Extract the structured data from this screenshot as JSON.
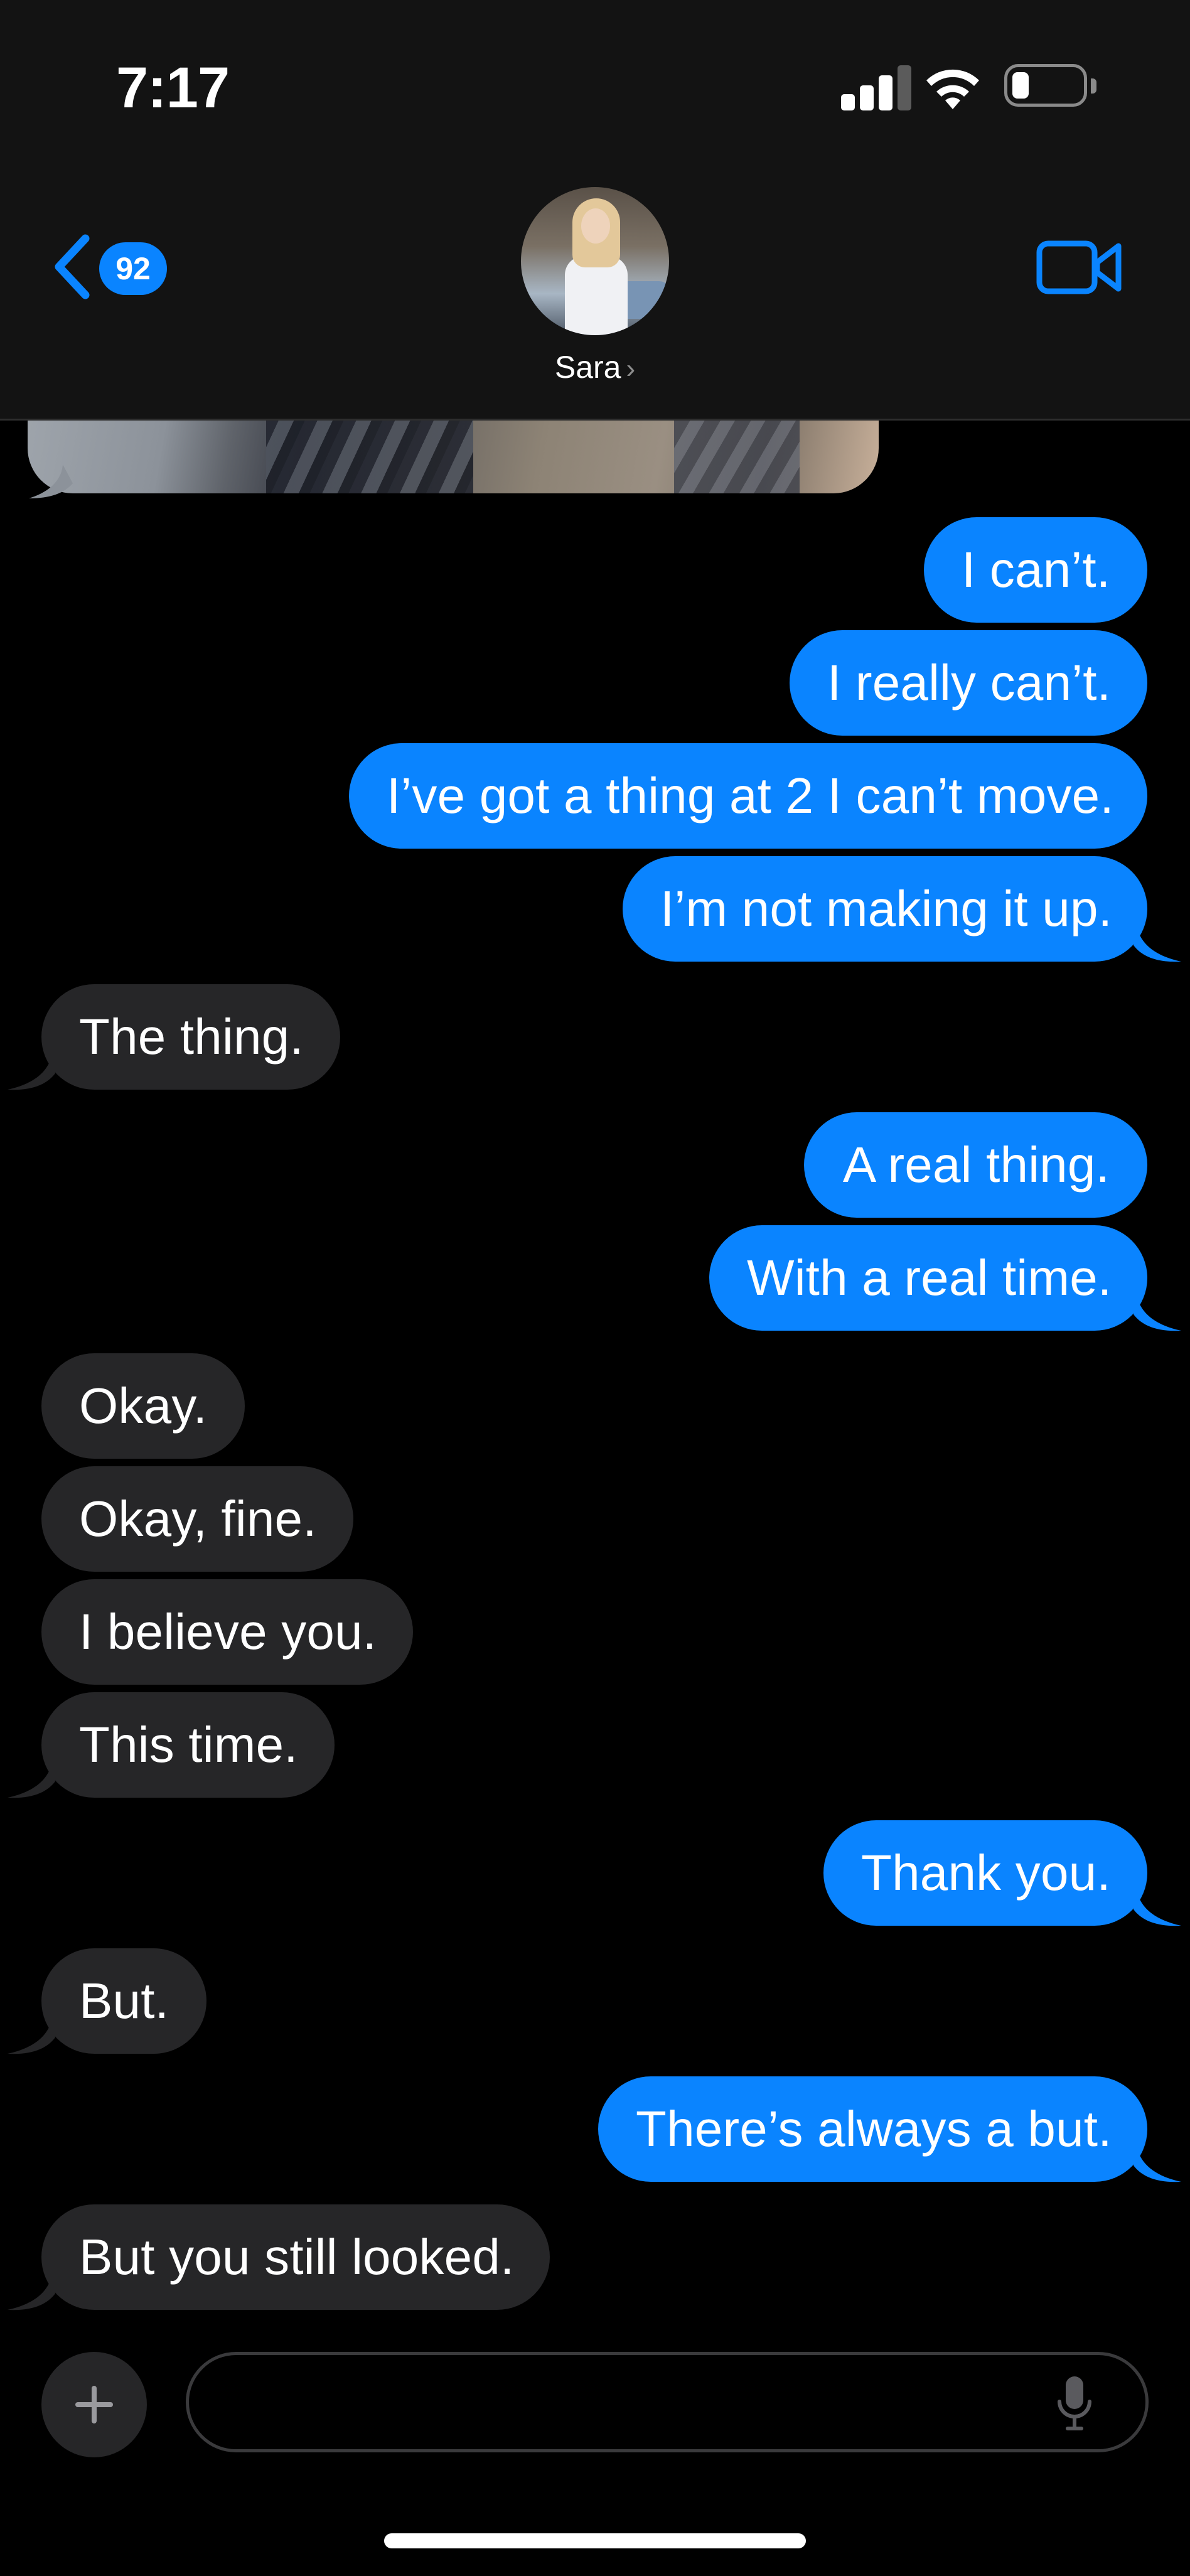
{
  "status_bar": {
    "time": "7:17",
    "signal_icon": "cellular-signal-icon",
    "wifi_icon": "wifi-icon",
    "battery_icon": "battery-low-icon",
    "battery_level": 0.2
  },
  "nav": {
    "back_icon": "chevron-left-icon",
    "unread_count": "92",
    "contact_name": "Sara",
    "contact_chevron": "›",
    "video_icon": "video-camera-icon"
  },
  "colors": {
    "accent": "#0a84ff",
    "sent_bubble": "#0a84ff",
    "received_bubble": "#262628",
    "background": "#000000",
    "header": "#131313"
  },
  "messages": [
    {
      "sender": "sent",
      "text": "I can’t."
    },
    {
      "sender": "sent",
      "text": "I really can’t."
    },
    {
      "sender": "sent",
      "text": "I’ve got a thing at 2 I can’t move."
    },
    {
      "sender": "sent",
      "text": "I’m not making it up."
    },
    {
      "sender": "received",
      "text": "The thing."
    },
    {
      "sender": "sent",
      "text": "A real thing."
    },
    {
      "sender": "sent",
      "text": "With a real time."
    },
    {
      "sender": "received",
      "text": "Okay."
    },
    {
      "sender": "received",
      "text": "Okay, fine."
    },
    {
      "sender": "received",
      "text": "I believe you."
    },
    {
      "sender": "received",
      "text": "This time."
    },
    {
      "sender": "sent",
      "text": "Thank you."
    },
    {
      "sender": "received",
      "text": "But."
    },
    {
      "sender": "sent",
      "text": "There’s always a but."
    },
    {
      "sender": "received",
      "text": "But you still looked."
    }
  ],
  "composer": {
    "plus_icon": "plus-icon",
    "input_value": "",
    "input_placeholder": "",
    "mic_icon": "microphone-icon"
  }
}
